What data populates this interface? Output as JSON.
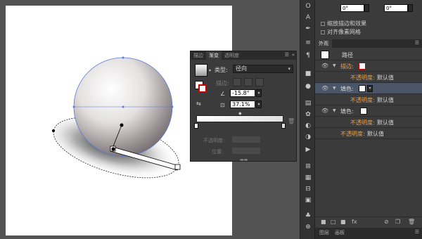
{
  "gradient_panel": {
    "tabs": [
      "描边",
      "渐变",
      "透明度"
    ],
    "active_tab_index": 1,
    "menu_icon": "panel-menu-icon",
    "type_label": "类型:",
    "type_value": "径向",
    "stroke_label": "描边:",
    "angle_value": "-15.8°",
    "aspect_value": "37.1%",
    "opacity_label": "不透明度:",
    "location_label": "位置:",
    "stop_left_color": "#ffffff",
    "stop_right_color": "#dddddd"
  },
  "toolbar": {
    "icons": [
      "type-icon",
      "character-icon",
      "pen-icon",
      "lines-icon",
      "paragraph-icon",
      "layers-icon",
      "swatches-icon",
      "color-guide-icon",
      "brushes-icon",
      "graphic-styles-icon",
      "symbols-icon",
      "transform-icon",
      "links-icon",
      "actions-icon",
      "align-icon",
      "pathfinder-icon",
      "artboards-icon",
      "navigator-icon",
      "stroke-icon"
    ]
  },
  "right_panel": {
    "top_field_1": "0°",
    "top_field_2": "0°",
    "checkbox_1_label": "缩放描边和效果",
    "checkbox_2_label": "对齐像素网格",
    "appearance_tab": "外观",
    "path_label": "路径",
    "rows": [
      {
        "type": "stroke",
        "label": "描边:",
        "color": "#ffffff"
      },
      {
        "type": "opacity",
        "label": "不透明度:",
        "value": "默认值"
      },
      {
        "type": "fill",
        "label": "填色:",
        "color": "#ffffff"
      },
      {
        "type": "opacity",
        "label": "不透明度:",
        "value": "默认值"
      },
      {
        "type": "fill",
        "label": "填色:",
        "color": "#ffffff"
      },
      {
        "type": "opacity",
        "label": "不透明度:",
        "value": "默认值"
      },
      {
        "type": "opacity",
        "label": "不透明度:",
        "value": "默认值"
      }
    ],
    "footer_tabs": [
      "图层",
      "画板"
    ]
  }
}
